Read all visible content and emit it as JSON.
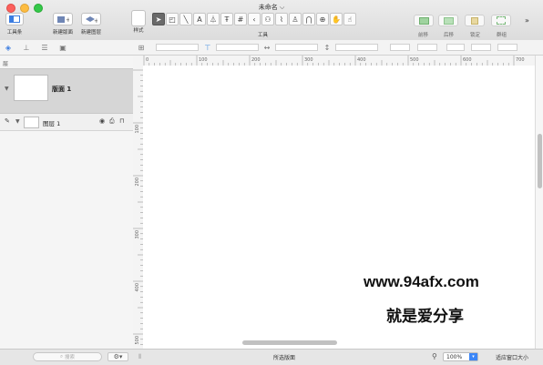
{
  "window": {
    "title": "未命名 ⌵"
  },
  "toolbar": {
    "toolbar_label": "工具条",
    "new_canvas_label": "新建版面",
    "new_layer_label": "新建图层",
    "style_label": "样式",
    "tools_label": "工具",
    "front_label": "前移",
    "back_label": "后移",
    "lock_label": "锁定",
    "group_label": "群组",
    "tools": [
      "selection-tool",
      "shape-tool",
      "line-tool",
      "text-tool",
      "pen-tool",
      "table-tool",
      "diagram-tool",
      "magnet-tool",
      "style-brush-tool",
      "rubber-stamp-tool",
      "magnet-point-tool",
      "zoom-tool",
      "hand-tool",
      "browse-tool"
    ]
  },
  "sidebar": {
    "header": "层",
    "canvas": {
      "name": "版面 1"
    },
    "layer": {
      "name": "图层 1"
    }
  },
  "rulers": {
    "h_ticks": [
      "0",
      "100",
      "200",
      "300",
      "400",
      "500",
      "600",
      "700"
    ],
    "v_ticks": [
      "100",
      "200",
      "300",
      "400",
      "500"
    ]
  },
  "watermark": {
    "line1": "www.94afx.com",
    "line2": "就是爱分享"
  },
  "statusbar": {
    "search_placeholder": "搜索",
    "center_text": "所选版面",
    "zoom_value": "100%",
    "fit_button": "适应窗口大小"
  }
}
